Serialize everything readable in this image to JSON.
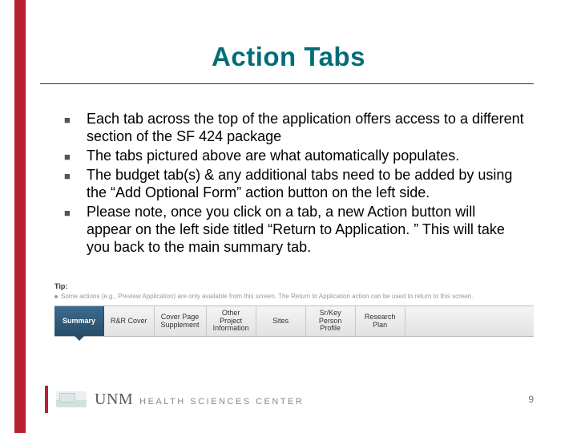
{
  "title": "Action Tabs",
  "bullets": [
    "Each tab across the top of the application offers access to a different section of the SF 424 package",
    "The tabs pictured above are what automatically populates.",
    "The budget tab(s) & any additional tabs need to be added by using the “Add Optional Form” action button on the left side.",
    "Please note, once you click on a tab, a new Action button will appear on the left side titled “Return to Application. ” This will take you back to the main summary tab."
  ],
  "tip": {
    "label": "Tip:",
    "text": "Some actions (e.g., Preview Application) are only available from this screen. The Return to Application action can be used to return to this screen."
  },
  "tabs": [
    {
      "label": "Summary",
      "active": true
    },
    {
      "label": "R&R Cover",
      "active": false
    },
    {
      "label": "Cover Page\nSupplement",
      "active": false
    },
    {
      "label": "Other\nProject\nInformation",
      "active": false
    },
    {
      "label": "Sites",
      "active": false
    },
    {
      "label": "Sr/Key\nPerson\nProfile",
      "active": false
    },
    {
      "label": "Research\nPlan",
      "active": false
    }
  ],
  "footer": {
    "org_short": "UNM",
    "org_long": "HEALTH SCIENCES CENTER",
    "page": "9"
  }
}
